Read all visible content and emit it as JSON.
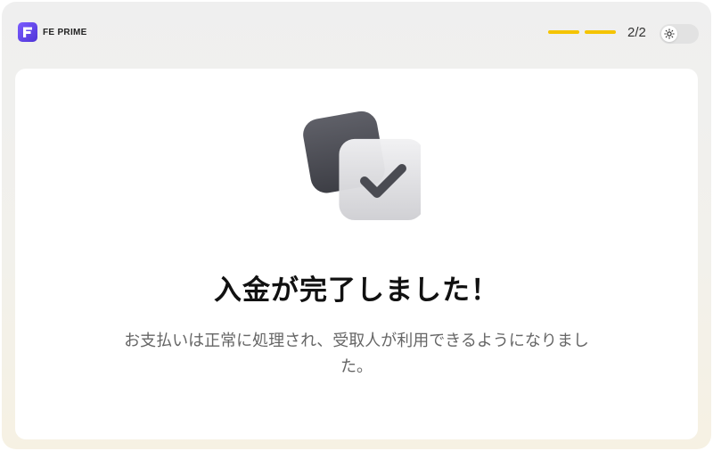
{
  "header": {
    "brand": "FE PRIME",
    "step_counter": "2/2",
    "progress_segments_filled": 2,
    "progress_segments_total": 2,
    "theme_toggle_icon": "sun-icon"
  },
  "main": {
    "illustration_icon": "checkmark-card-icon",
    "title": "入金が完了しました！",
    "description": "お支払いは正常に処理され、受取人が利用できるようになりました。"
  },
  "colors": {
    "accent": "#f5c400",
    "brand": "#6a4cf2"
  }
}
